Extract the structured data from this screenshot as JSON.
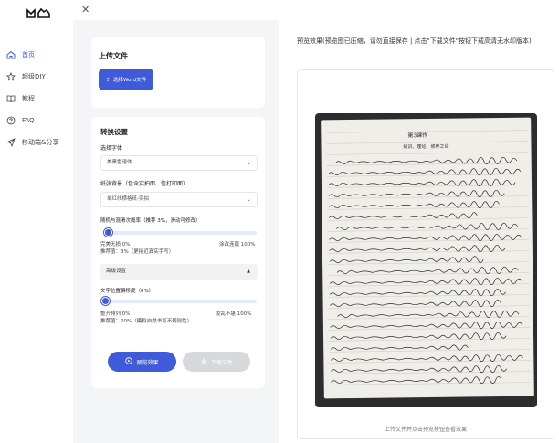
{
  "sidebar": {
    "items": [
      {
        "label": "首页",
        "icon": "home-icon",
        "active": true
      },
      {
        "label": "超级DIY",
        "icon": "star-icon",
        "active": false
      },
      {
        "label": "教程",
        "icon": "book-icon",
        "active": false
      },
      {
        "label": "FAQ",
        "icon": "help-circle-icon",
        "active": false
      },
      {
        "label": "移动端&分享",
        "icon": "send-icon",
        "active": false
      }
    ]
  },
  "upload": {
    "title": "上传文件",
    "button_label": "选择Word文件"
  },
  "settings": {
    "title": "转换设置",
    "font_label": "选择字体",
    "font_value": "美黑雷速体",
    "background_label": "纸张背景（包含实拍面、信打印面）",
    "background_value": "单红线横格纸-实拍",
    "disorder_label": "随机与混淆次概率（推荐 3%，滑动可修改）",
    "disorder_min": "完美无损 0%",
    "disorder_max": "涂改连篇 100%",
    "disorder_recommend": "推荐值：3%（更接近真实手写）",
    "disorder_percent": 3,
    "advanced_label": "高级设置",
    "offset_label": "文字位置偏移度（0%）",
    "offset_min": "整齐排列 0%",
    "offset_max": "凌乱不堪 100%",
    "offset_recommend": "推荐值：20%（模拟自然书写不规则性）",
    "offset_percent": 0
  },
  "actions": {
    "preview_label": "预览效果",
    "download_label": "下载文件"
  },
  "preview": {
    "title": "预览效果(预览图已压缩，请勿直接保存 | 点击\"下载文件\"按钮下载高清无水印版本)",
    "hint": "上传文件并点击预览按钮查看效果",
    "sample_heading": "第3课作",
    "sample_subheading": "知识、理论、修养之论"
  },
  "colors": {
    "accent": "#3f5bd9",
    "panel_bg": "#f4f5f7"
  }
}
